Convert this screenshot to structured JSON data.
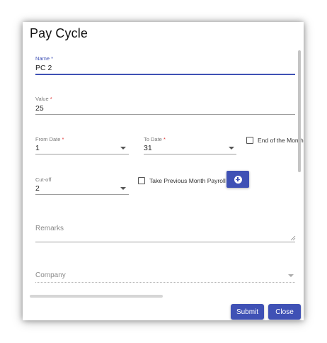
{
  "dialog": {
    "title": "Pay Cycle",
    "name": {
      "label": "Name",
      "required": "*",
      "value": "PC 2"
    },
    "value": {
      "label": "Value",
      "required": "*",
      "value": "25"
    },
    "from_date": {
      "label": "From Date",
      "required": "*",
      "value": "1"
    },
    "to_date": {
      "label": "To Date",
      "required": "*",
      "value": "31"
    },
    "end_of_month": {
      "label": "End of the Month",
      "checked": false
    },
    "cutoff": {
      "label": "Cut-off",
      "value": "2"
    },
    "take_previous": {
      "label": "Take Previous Month Payroll",
      "checked": false
    },
    "add_button_icon": "plus-circle-icon",
    "remarks": {
      "placeholder": "Remarks"
    },
    "company": {
      "placeholder": "Company"
    },
    "buttons": {
      "submit": "Submit",
      "close": "Close"
    }
  },
  "colors": {
    "primary": "#3f51b5",
    "required": "#dd3333"
  }
}
